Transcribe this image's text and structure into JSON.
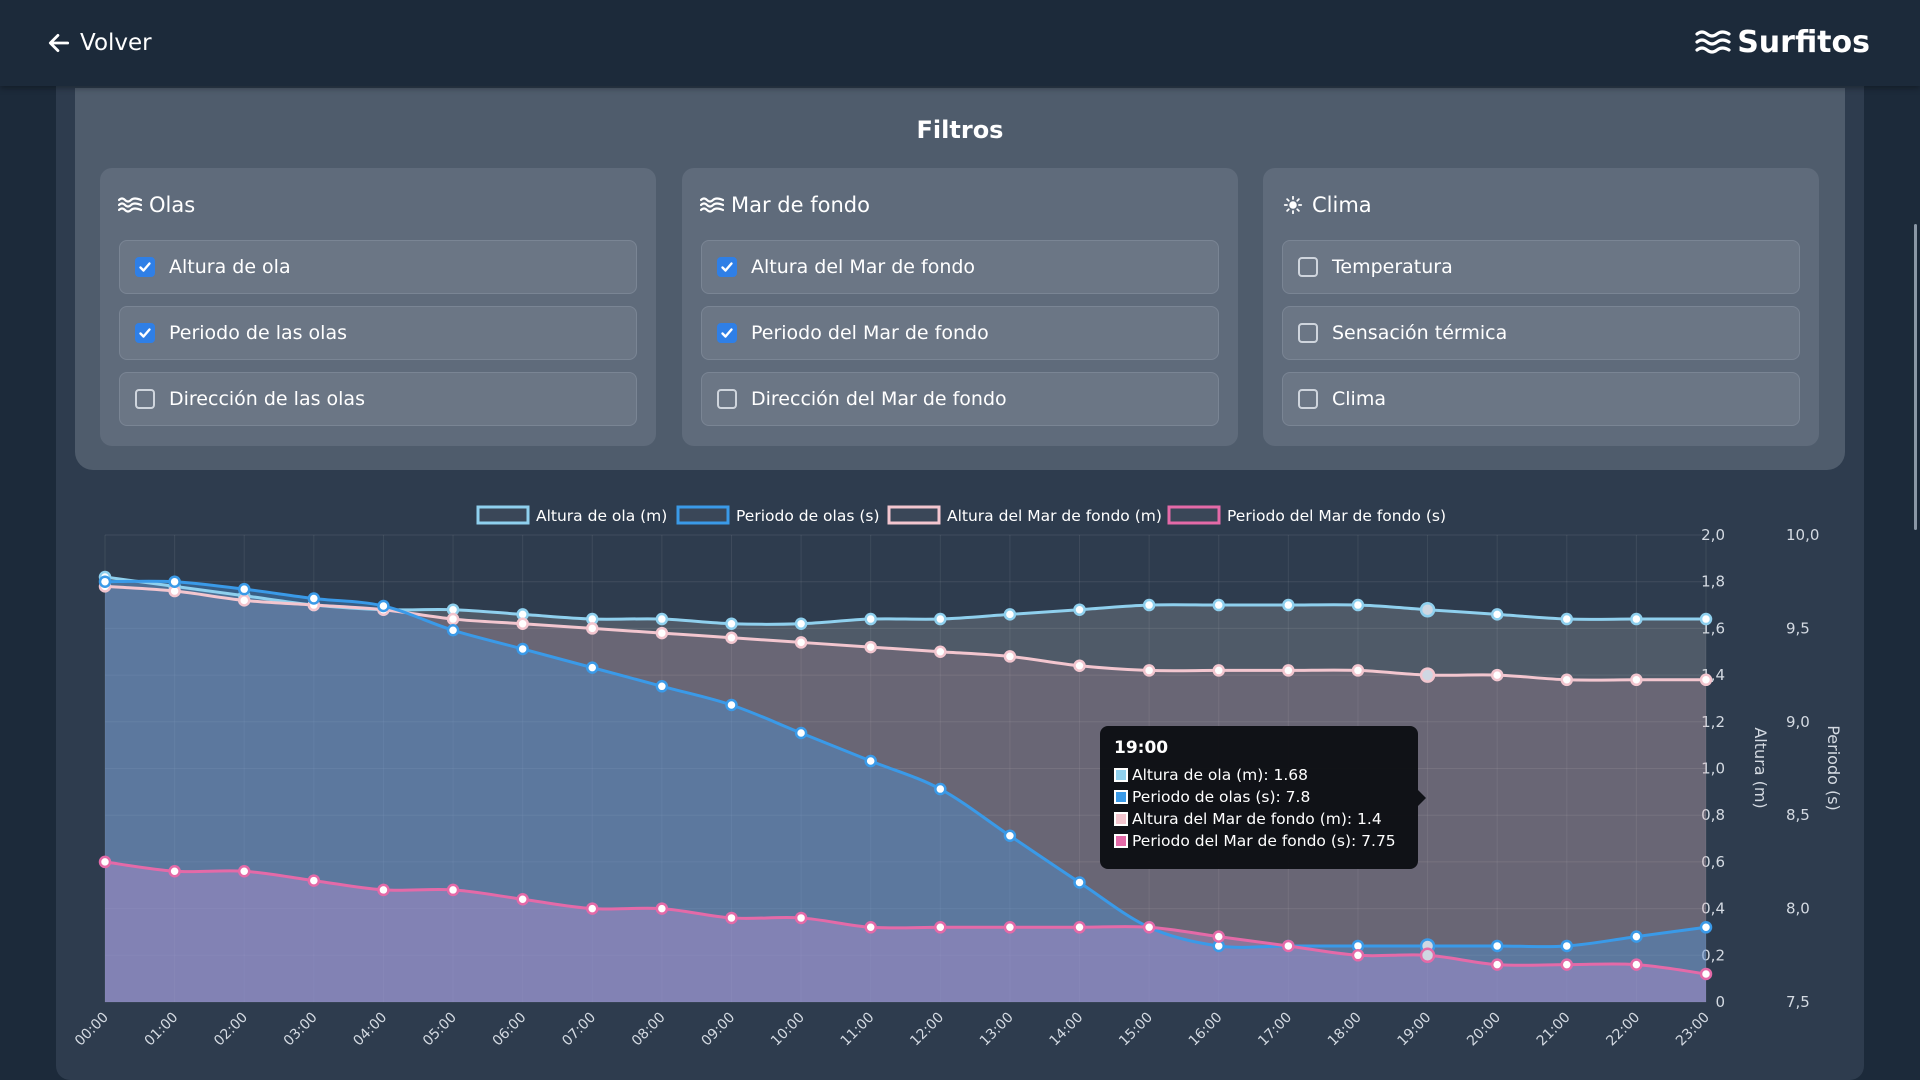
{
  "header": {
    "back_label": "Volver",
    "brand": "Surfitos"
  },
  "filters": {
    "title": "Filtros",
    "groups": [
      {
        "title": "Olas",
        "icon": "waves-icon",
        "options": [
          {
            "label": "Altura de ola",
            "checked": true
          },
          {
            "label": "Periodo de las olas",
            "checked": true
          },
          {
            "label": "Dirección de las olas",
            "checked": false
          }
        ]
      },
      {
        "title": "Mar de fondo",
        "icon": "waves-icon",
        "options": [
          {
            "label": "Altura del Mar de fondo",
            "checked": true
          },
          {
            "label": "Periodo del Mar de fondo",
            "checked": true
          },
          {
            "label": "Dirección del Mar de fondo",
            "checked": false
          }
        ]
      },
      {
        "title": "Clima",
        "icon": "sun-icon",
        "options": [
          {
            "label": "Temperatura",
            "checked": false
          },
          {
            "label": "Sensación térmica",
            "checked": false
          },
          {
            "label": "Clima",
            "checked": false
          }
        ]
      }
    ]
  },
  "chart_data": {
    "type": "area",
    "x": [
      "00:00",
      "01:00",
      "02:00",
      "03:00",
      "04:00",
      "05:00",
      "06:00",
      "07:00",
      "08:00",
      "09:00",
      "10:00",
      "11:00",
      "12:00",
      "13:00",
      "14:00",
      "15:00",
      "16:00",
      "17:00",
      "18:00",
      "19:00",
      "20:00",
      "21:00",
      "22:00",
      "23:00"
    ],
    "series": [
      {
        "name": "Altura de ola (m)",
        "axis": "left",
        "color": "#8fd0ee",
        "values": [
          1.82,
          1.78,
          1.74,
          1.7,
          1.68,
          1.68,
          1.66,
          1.64,
          1.64,
          1.62,
          1.62,
          1.64,
          1.64,
          1.66,
          1.68,
          1.7,
          1.7,
          1.7,
          1.7,
          1.68,
          1.66,
          1.64,
          1.64,
          1.64
        ]
      },
      {
        "name": "Periodo de olas (s)",
        "axis": "right",
        "color": "#3a9ae8",
        "values": [
          9.75,
          9.75,
          9.71,
          9.66,
          9.62,
          9.49,
          9.39,
          9.29,
          9.19,
          9.09,
          8.94,
          8.79,
          8.64,
          8.39,
          8.14,
          7.9,
          7.8,
          7.8,
          7.8,
          7.8,
          7.8,
          7.8,
          7.85,
          7.9
        ]
      },
      {
        "name": "Altura del Mar de fondo (m)",
        "axis": "left",
        "color": "#f3c6cf",
        "values": [
          1.78,
          1.76,
          1.72,
          1.7,
          1.68,
          1.64,
          1.62,
          1.6,
          1.58,
          1.56,
          1.54,
          1.52,
          1.5,
          1.48,
          1.44,
          1.42,
          1.42,
          1.42,
          1.42,
          1.4,
          1.4,
          1.38,
          1.38,
          1.38
        ]
      },
      {
        "name": "Periodo del Mar de fondo (s)",
        "axis": "right",
        "color": "#e46aa8",
        "values": [
          8.25,
          8.2,
          8.2,
          8.15,
          8.1,
          8.1,
          8.05,
          8.0,
          8.0,
          7.95,
          7.95,
          7.9,
          7.9,
          7.9,
          7.9,
          7.9,
          7.85,
          7.8,
          7.75,
          7.75,
          7.7,
          7.7,
          7.7,
          7.65
        ]
      }
    ],
    "yleft": {
      "label": "Altura (m)",
      "ylim": [
        0,
        2.0
      ],
      "ticks": [
        "0",
        "0,2",
        "0,4",
        "0,6",
        "0,8",
        "1,0",
        "1,2",
        "1,4",
        "1,6",
        "1,8",
        "2,0"
      ]
    },
    "yright": {
      "label": "Periodo (s)",
      "ylim": [
        7.5,
        10.0
      ],
      "ticks": [
        "7,5",
        "8,0",
        "8,5",
        "9,0",
        "9,5",
        "10,0"
      ]
    },
    "grid": true,
    "legend_position": "top-center"
  },
  "tooltip": {
    "title": "19:00",
    "rows": [
      {
        "text": "Altura de ola (m): 1.68",
        "color": "#8fd0ee"
      },
      {
        "text": "Periodo de olas (s): 7.8",
        "color": "#3a9ae8"
      },
      {
        "text": "Altura del Mar de fondo (m): 1.4",
        "color": "#f3c6cf"
      },
      {
        "text": "Periodo del Mar de fondo (s): 7.75",
        "color": "#e46aa8"
      }
    ]
  }
}
